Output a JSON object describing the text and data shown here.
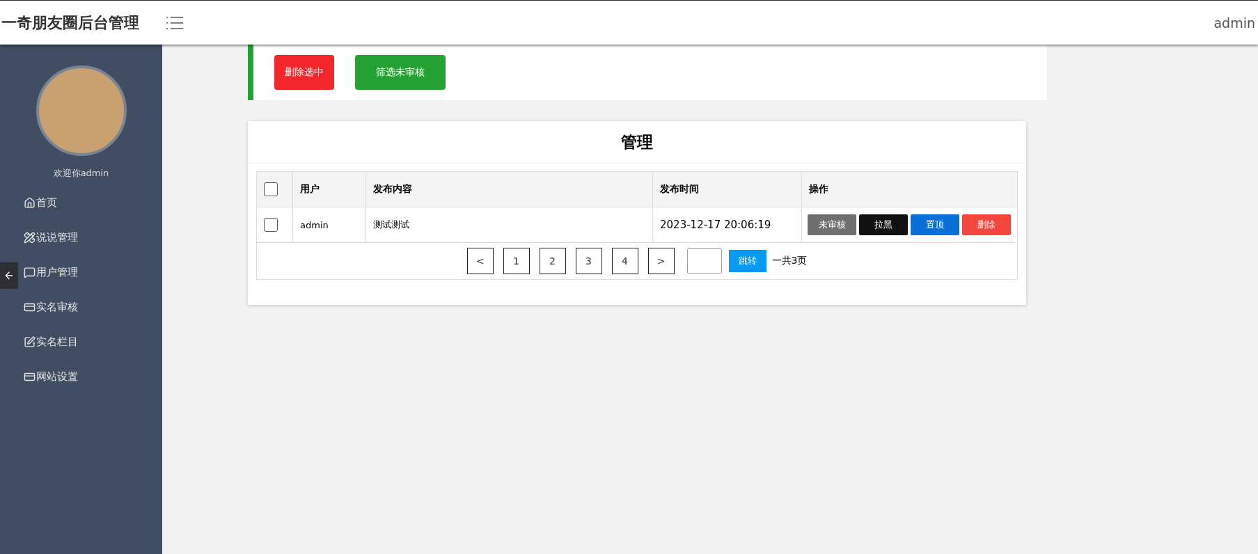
{
  "header": {
    "title": "一奇朋友圈后台管理",
    "user": "admin"
  },
  "sidebar": {
    "welcome": "欢迎你admin",
    "items": [
      {
        "label": "首页",
        "kind": "home"
      },
      {
        "label": "说说管理",
        "kind": "tools"
      },
      {
        "label": "用户管理",
        "kind": "chat"
      },
      {
        "label": "实名审核",
        "kind": "card"
      },
      {
        "label": "实名栏目",
        "kind": "edit"
      },
      {
        "label": "网站设置",
        "kind": "card"
      }
    ]
  },
  "actions": [
    {
      "label": "删除选中",
      "kind": "danger"
    },
    {
      "label": "筛选未审核",
      "kind": "success"
    }
  ],
  "panel": {
    "title": "管理",
    "table": {
      "select_all": {
        "checked": false
      },
      "columns": [
        "用户",
        "发布内容",
        "发布时间",
        "操作"
      ],
      "rows": [
        {
          "checked": false,
          "user": "admin",
          "content": "测试测试",
          "time": "2023-12-17 20:06:19",
          "ops": [
            {
              "label": "未审核",
              "kind": "gray"
            },
            {
              "label": "拉黑",
              "kind": "black"
            },
            {
              "label": "置顶",
              "kind": "blue"
            },
            {
              "label": "删除",
              "kind": "red"
            }
          ]
        }
      ]
    },
    "pagination": {
      "pages": [
        "<",
        "1",
        "2",
        "3",
        "4",
        ">"
      ],
      "jump": "跳转",
      "total": "一共3页"
    }
  }
}
